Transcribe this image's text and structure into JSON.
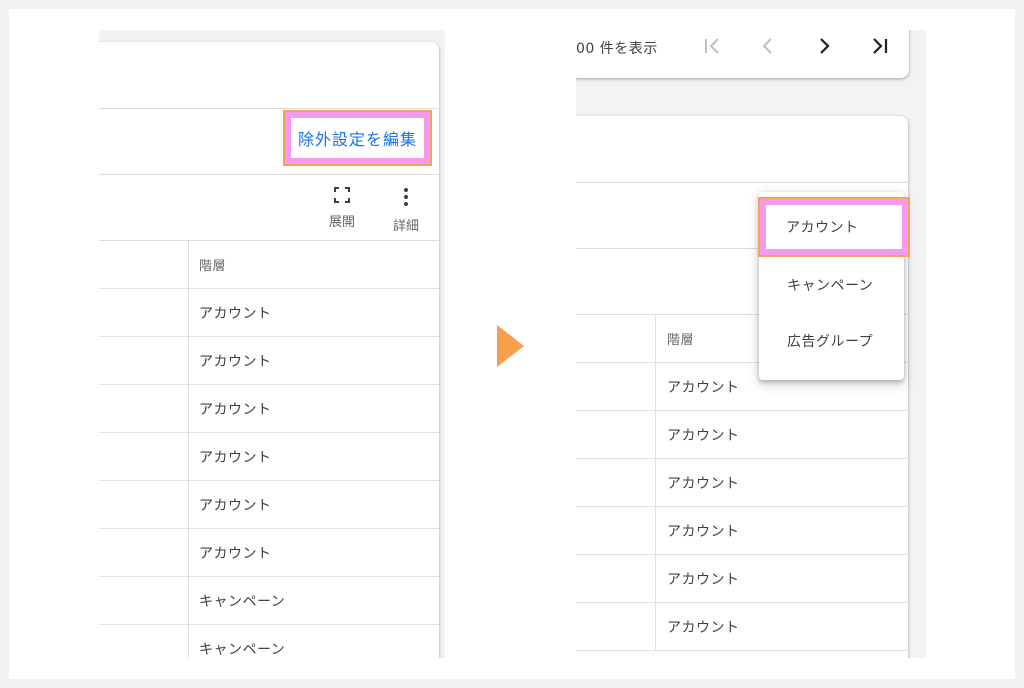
{
  "left": {
    "edit_link": "除外設定を編集",
    "toolbar": {
      "expand_label": "展開",
      "more_label": "詳細"
    },
    "table": {
      "header": "階層",
      "rows": [
        "アカウント",
        "アカウント",
        "アカウント",
        "アカウント",
        "アカウント",
        "アカウント",
        "キャンペーン",
        "キャンペーン"
      ]
    }
  },
  "right": {
    "pager": {
      "text": "00 件を表示"
    },
    "menu": {
      "items": [
        "アカウント",
        "キャンペーン",
        "広告グループ"
      ]
    },
    "table": {
      "header": "階層",
      "rows": [
        "アカウント",
        "アカウント",
        "アカウント",
        "アカウント",
        "アカウント",
        "アカウント"
      ]
    }
  },
  "colors": {
    "highlight_fill": "#f59bef",
    "highlight_border": "#f4a35a",
    "link": "#1a73e8",
    "arrow": "#f6a04d"
  }
}
